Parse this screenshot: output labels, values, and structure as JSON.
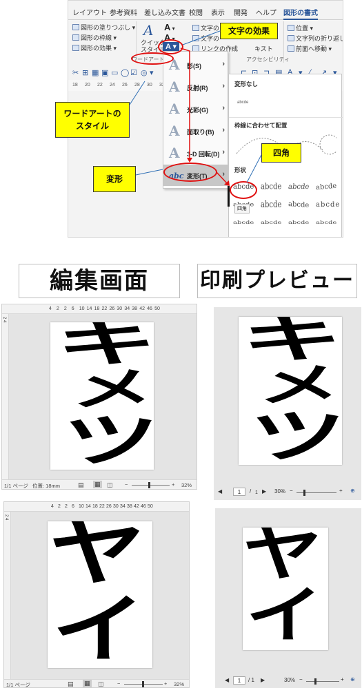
{
  "ribbon": {
    "tabs": [
      "レイアウト",
      "参考資料",
      "差し込み文書",
      "校閲",
      "表示",
      "開発",
      "ヘルプ",
      "図形の書式"
    ],
    "shape_fill": "図形の塗りつぶし",
    "shape_outline": "図形の枠線",
    "shape_effects": "図形の効果",
    "quick_style_1": "クイック",
    "quick_style_2": "スタイル",
    "wordart_group": "ワードアートの",
    "text_label_1": "文字の",
    "text_label_2": "文字の",
    "link": "リンクの作成",
    "text_partial": "キスト",
    "accessibility": "アクセシビリティ",
    "position": "位置",
    "wrap": "文字列の折り返し",
    "bring_forward": "前面へ移動",
    "ruler_ticks": [
      "18",
      "20",
      "22",
      "24",
      "26",
      "28",
      "30",
      "32",
      "34",
      "36",
      "38"
    ]
  },
  "effects_menu": {
    "items": [
      {
        "label": "影(S)",
        "glyph": "A"
      },
      {
        "label": "反射(R)",
        "glyph": "A"
      },
      {
        "label": "光彩(G)",
        "glyph": "A"
      },
      {
        "label": "面取り(B)",
        "glyph": "A"
      },
      {
        "label": "3-D 回転(D)",
        "glyph": "A"
      },
      {
        "label": "変形(T)",
        "glyph": "abc"
      }
    ]
  },
  "transform_panel": {
    "no_transform": "変形なし",
    "sample": "abcde",
    "follow_path": "枠線に合わせて配置",
    "shape_header": "形状",
    "warp_sample": "abcde",
    "tooltip": "四角"
  },
  "callouts": {
    "text_effects": "文字の効果",
    "wordart_styles": "ワードアートの\nスタイル",
    "transform": "変形",
    "square": "四角"
  },
  "sections": {
    "edit_screen": "編集画面",
    "print_preview": "印刷プレビュー"
  },
  "editor": {
    "ruler_ticks": [
      "4",
      "2",
      "2",
      "6",
      "10",
      "14",
      "18",
      "22",
      "26",
      "30",
      "34",
      "38",
      "42",
      "46",
      "50"
    ],
    "vruler": "2 4",
    "status_page_1": "1/1 ページ",
    "status_position": "位置: 18mm",
    "status_page_2": "1/1 ページ",
    "zoom_1": "32%",
    "zoom_2": "32%",
    "text_1": [
      "キ",
      "メ",
      "ツ"
    ],
    "text_2": [
      "ヤ",
      "イ"
    ]
  },
  "preview": {
    "page_num_1": "1",
    "page_total_1": "1",
    "zoom_1": "30%",
    "page_num_2": "1",
    "page_total_2": "/ 1",
    "zoom_2": "30%",
    "text_1": [
      "キ",
      "メ",
      "ツ"
    ],
    "text_2": [
      "ヤ",
      "イ"
    ]
  },
  "colors": {
    "callout": "#ffff00",
    "highlight_ring": "#e01010",
    "accent": "#2b579a"
  }
}
